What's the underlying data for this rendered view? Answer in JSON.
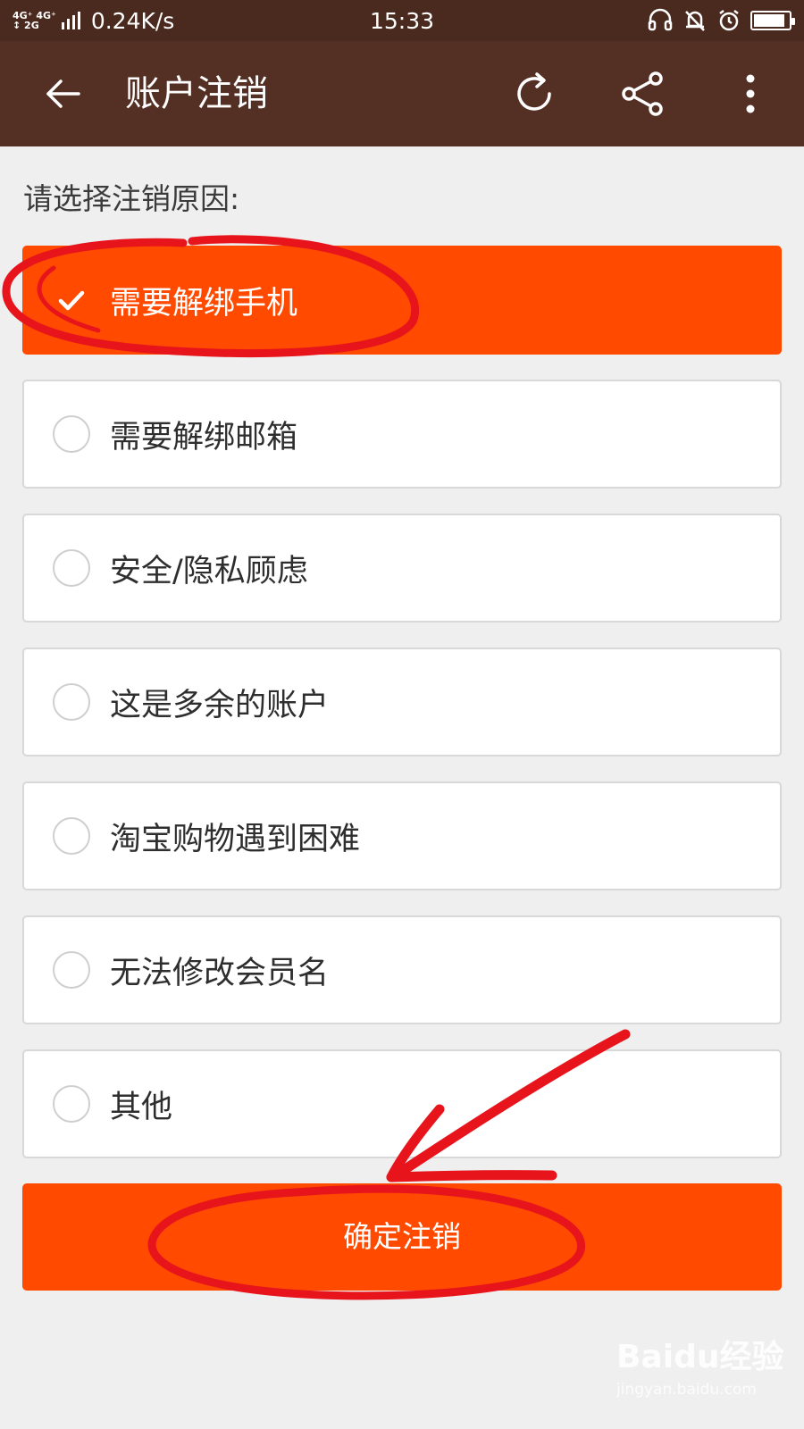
{
  "status_bar": {
    "net_top": "4G⁺ 4G⁺",
    "net_bottom": "↕ 2G",
    "speed": "0.24K/s",
    "time": "15:33",
    "icons": [
      "headset-icon",
      "bell-muted-icon",
      "alarm-icon",
      "battery-icon"
    ],
    "battery_level": 0.9
  },
  "app_bar": {
    "title": "账户注销",
    "icons": [
      "back-arrow-icon",
      "refresh-icon",
      "share-icon",
      "more-vertical-icon"
    ]
  },
  "prompt": "请选择注销原因:",
  "options": [
    {
      "label": "需要解绑手机",
      "selected": true
    },
    {
      "label": "需要解绑邮箱",
      "selected": false
    },
    {
      "label": "安全/隐私顾虑",
      "selected": false
    },
    {
      "label": "这是多余的账户",
      "selected": false
    },
    {
      "label": "淘宝购物遇到困难",
      "selected": false
    },
    {
      "label": "无法修改会员名",
      "selected": false
    },
    {
      "label": "其他",
      "selected": false
    }
  ],
  "submit_label": "确定注销",
  "watermark": {
    "brand": "Baidu经验",
    "sub": "jingyan.baidu.com"
  },
  "colors": {
    "accent": "#ff4a00",
    "app_bar": "#542f23",
    "status_bar": "#4a2a1e",
    "annotation": "#e8141c"
  }
}
